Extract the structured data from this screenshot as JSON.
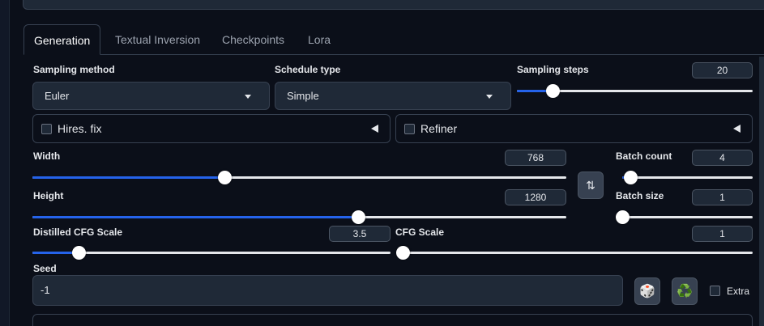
{
  "tabs": [
    {
      "label": "Generation",
      "active": true
    },
    {
      "label": "Textual Inversion",
      "active": false
    },
    {
      "label": "Checkpoints",
      "active": false
    },
    {
      "label": "Lora",
      "active": false
    }
  ],
  "sampling_method": {
    "label": "Sampling method",
    "value": "Euler"
  },
  "schedule_type": {
    "label": "Schedule type",
    "value": "Simple"
  },
  "sampling_steps": {
    "label": "Sampling steps",
    "value": "20",
    "fraction": 0.15
  },
  "hires_fix": {
    "label": "Hires. fix",
    "checked": false
  },
  "refiner": {
    "label": "Refiner",
    "checked": false
  },
  "width": {
    "label": "Width",
    "value": "768",
    "fraction": 0.36
  },
  "height": {
    "label": "Height",
    "value": "1280",
    "fraction": 0.61
  },
  "batch_count": {
    "label": "Batch count",
    "value": "4",
    "fraction": 0.06
  },
  "batch_size": {
    "label": "Batch size",
    "value": "1",
    "fraction": 0.0
  },
  "swap_icon": "swap-vertical-icon",
  "distilled_cfg": {
    "label": "Distilled CFG Scale",
    "value": "3.5",
    "fraction": 0.13
  },
  "cfg_scale": {
    "label": "CFG Scale",
    "value": "1",
    "fraction": 0.0
  },
  "seed": {
    "label": "Seed",
    "value": "-1"
  },
  "extra": {
    "label": "Extra",
    "checked": false
  },
  "icons": {
    "dice": "🎲",
    "recycle": "♻️",
    "swap": "⇅"
  },
  "colors": {
    "accent": "#2563eb",
    "background": "#0b0f19",
    "panel": "#1f2937"
  }
}
